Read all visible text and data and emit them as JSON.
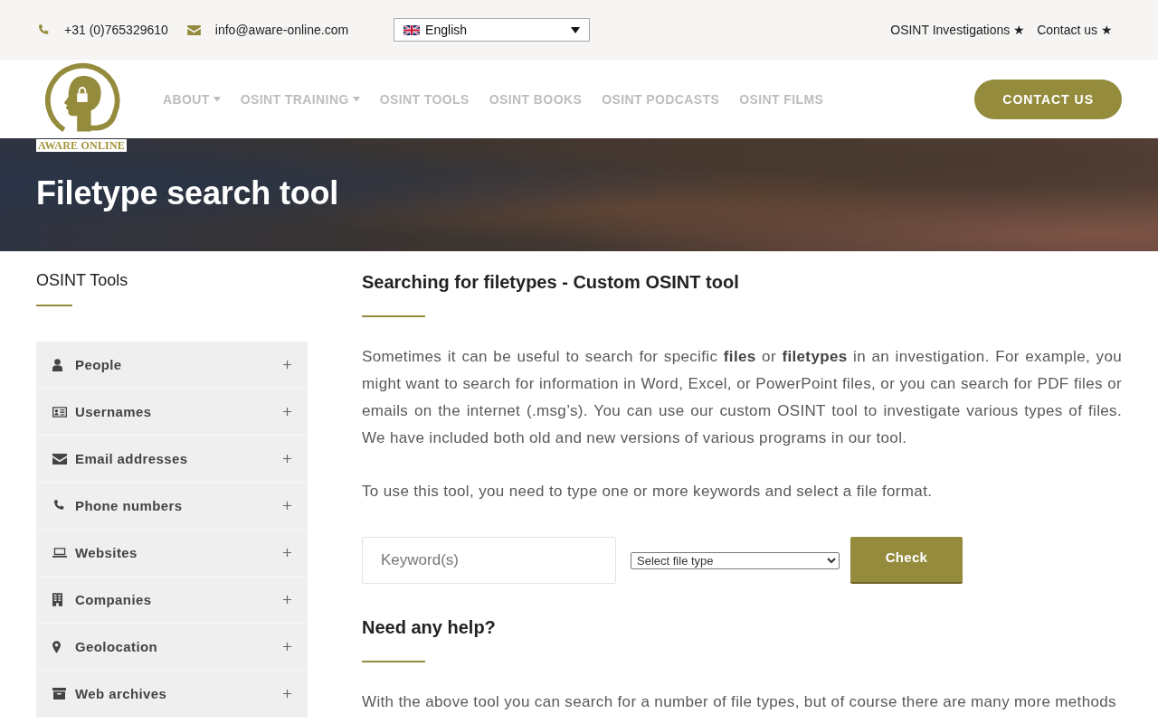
{
  "topbar": {
    "phone": "+31 (0)765329610",
    "email": "info@aware-online.com",
    "language": "English",
    "links": [
      "OSINT Investigations ★",
      "Contact us ★"
    ]
  },
  "header": {
    "logo_text": "AWARE ONLINE",
    "nav": [
      {
        "label": "ABOUT",
        "dropdown": true
      },
      {
        "label": "OSINT TRAINING",
        "dropdown": true
      },
      {
        "label": "OSINT TOOLS",
        "dropdown": false
      },
      {
        "label": "OSINT BOOKS",
        "dropdown": false
      },
      {
        "label": "OSINT PODCASTS",
        "dropdown": false
      },
      {
        "label": "OSINT FILMS",
        "dropdown": false
      }
    ],
    "cta": "CONTACT US"
  },
  "hero": {
    "title": "Filetype search tool"
  },
  "sidebar": {
    "title": "OSINT Tools",
    "items": [
      {
        "label": "People",
        "expanded": false
      },
      {
        "label": "Usernames",
        "expanded": false
      },
      {
        "label": "Email addresses",
        "expanded": false
      },
      {
        "label": "Phone numbers",
        "expanded": false
      },
      {
        "label": "Websites",
        "expanded": false
      },
      {
        "label": "Companies",
        "expanded": false
      },
      {
        "label": "Geolocation",
        "expanded": false
      },
      {
        "label": "Web archives",
        "expanded": false
      }
    ]
  },
  "main": {
    "heading": "Searching for filetypes - Custom OSINT tool",
    "paragraphs": [
      "Sometimes it can be useful to search for specific **files** or **filetypes** in an investigation. For example, you might want to search for information in Word, Excel, or PowerPoint files, or you can search for PDF files or emails on the internet (.msg’s). You can use our custom OSINT tool to investigate various types of files. We have included both old and new versions of various programs in our tool.",
      "To use this tool, you need to type one or more keywords and select a file format."
    ],
    "form": {
      "keyword_placeholder": "Keyword(s)",
      "filetype": "Select file type",
      "button": "Check"
    },
    "help": {
      "heading": "Need any help?",
      "paragraphs": [
        "With the above tool you can search for a number of file types, but of course there are many more methods"
      ]
    }
  }
}
